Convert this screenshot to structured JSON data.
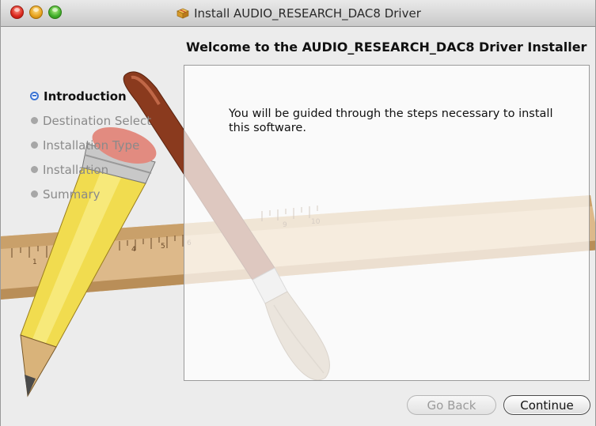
{
  "window": {
    "title": "Install AUDIO_RESEARCH_DAC8 Driver",
    "heading": "Welcome to the AUDIO_RESEARCH_DAC8 Driver Installer"
  },
  "steps": [
    {
      "label": "Introduction",
      "active": true
    },
    {
      "label": "Destination Select",
      "active": false
    },
    {
      "label": "Installation Type",
      "active": false
    },
    {
      "label": "Installation",
      "active": false
    },
    {
      "label": "Summary",
      "active": false
    }
  ],
  "content": {
    "message": "You will be guided through the steps necessary to install this software."
  },
  "buttons": {
    "back_label": "Go Back",
    "continue_label": "Continue"
  },
  "ruler": {
    "numbers": [
      "1",
      "4",
      "5",
      "6",
      "9",
      "10"
    ]
  },
  "colors": {
    "accent": "#3b74d4",
    "pencil_yellow": "#f1dc4f",
    "ruler_wood": "#ddb98a",
    "brush_handle": "#8a3a1e"
  },
  "icons": {
    "title_icon": "package-icon",
    "step_active": "radio-active-icon",
    "step_inactive": "gray-dot-icon"
  }
}
